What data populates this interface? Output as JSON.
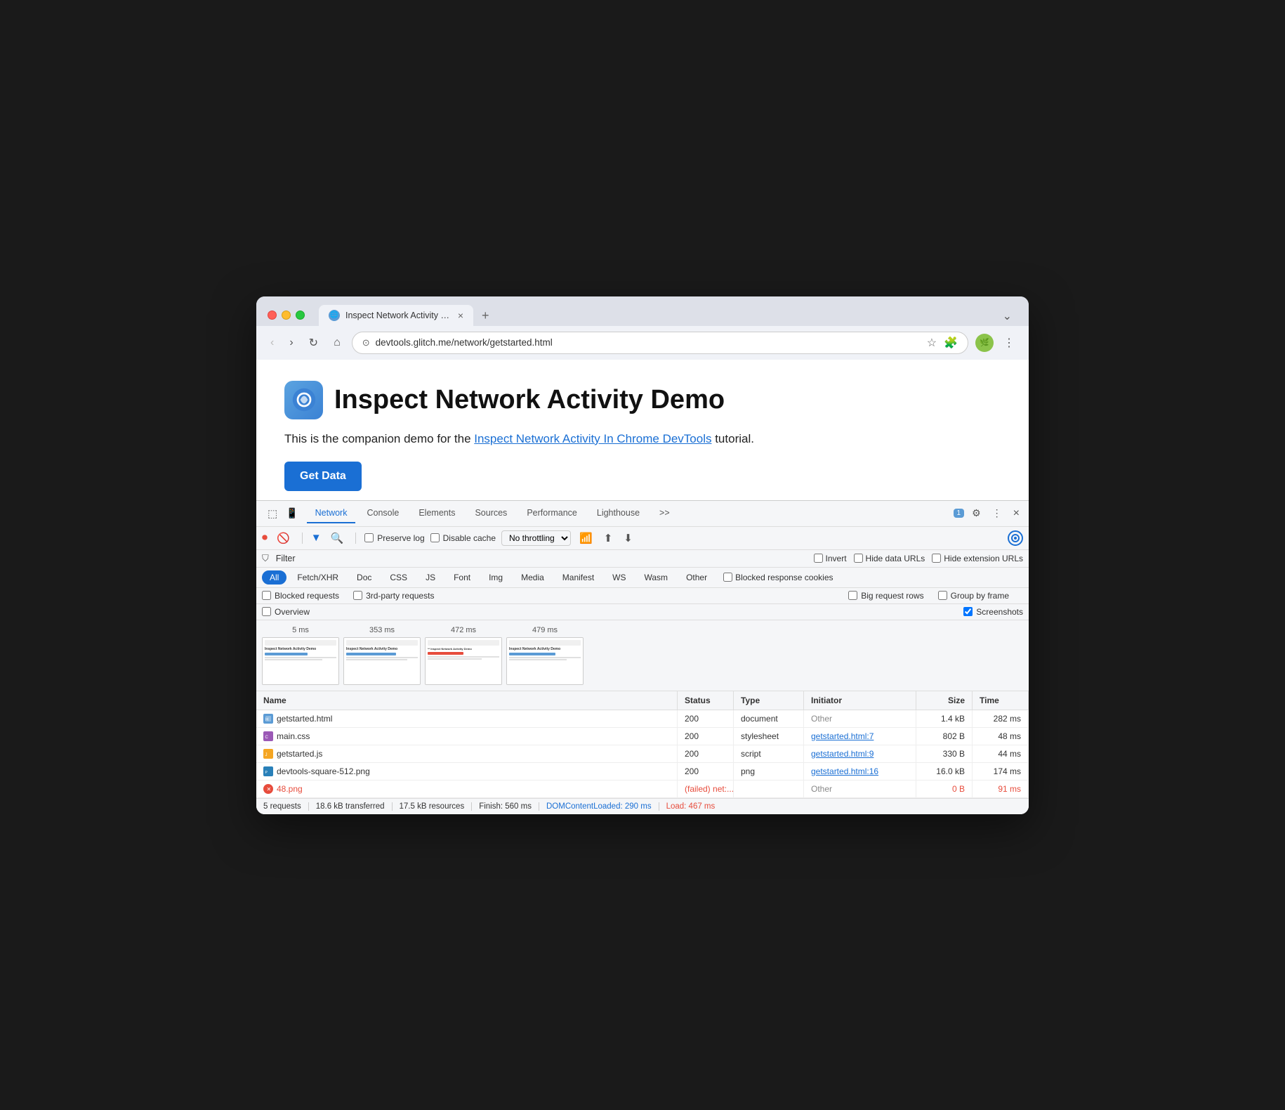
{
  "browser": {
    "tab_title": "Inspect Network Activity Dem",
    "tab_close": "×",
    "new_tab": "+",
    "dropdown_arrow": "⌄",
    "back_btn": "←",
    "forward_btn": "→",
    "refresh_btn": "↻",
    "home_btn": "⌂",
    "address": "devtools.glitch.me/network/getstarted.html",
    "bookmark_icon": "☆",
    "extensions_icon": "🧩",
    "menu_icon": "⋮"
  },
  "page": {
    "title": "Inspect Network Activity Demo",
    "description_before": "This is the companion demo for the ",
    "link_text": "Inspect Network Activity In Chrome DevTools",
    "description_after": " tutorial.",
    "get_data_btn": "Get Data"
  },
  "devtools": {
    "tabs": [
      "Network",
      "Console",
      "Elements",
      "Sources",
      "Performance",
      "Lighthouse",
      ">>"
    ],
    "active_tab": "Network",
    "badge_count": "1",
    "settings_icon": "⚙",
    "more_icon": "⋮",
    "close_icon": "×"
  },
  "network_controls": {
    "stop_recording": "⏹",
    "clear": "🚫",
    "filter_icon": "⛉",
    "search_icon": "🔍",
    "preserve_log": "Preserve log",
    "disable_cache": "Disable cache",
    "throttling": "No throttling",
    "wifi_icon": "📶",
    "upload_icon": "⬆",
    "download_icon": "⬇",
    "settings_ring": "⚙"
  },
  "filter_row": {
    "filter_label": "Filter",
    "invert": "Invert",
    "hide_data_urls": "Hide data URLs",
    "hide_extension_urls": "Hide extension URLs"
  },
  "type_filters": [
    "All",
    "Fetch/XHR",
    "Doc",
    "CSS",
    "JS",
    "Font",
    "Img",
    "Media",
    "Manifest",
    "WS",
    "Wasm",
    "Other"
  ],
  "active_type": "All",
  "blocked_cookies": "Blocked response cookies",
  "options": {
    "blocked_requests": "Blocked requests",
    "third_party": "3rd-party requests",
    "big_rows": "Big request rows",
    "group_by_frame": "Group by frame",
    "overview": "Overview",
    "screenshots": "Screenshots",
    "screenshots_checked": true
  },
  "screenshots": [
    {
      "time": "5 ms"
    },
    {
      "time": "353 ms"
    },
    {
      "time": "472 ms"
    },
    {
      "time": "479 ms"
    }
  ],
  "table": {
    "headers": [
      "Name",
      "Status",
      "Type",
      "Initiator",
      "Size",
      "Time"
    ],
    "rows": [
      {
        "name": "getstarted.html",
        "icon_type": "html",
        "status": "200",
        "type": "document",
        "initiator": "Other",
        "initiator_link": false,
        "size": "1.4 kB",
        "time": "282 ms",
        "error": false
      },
      {
        "name": "main.css",
        "icon_type": "css",
        "status": "200",
        "type": "stylesheet",
        "initiator": "getstarted.html:7",
        "initiator_link": true,
        "size": "802 B",
        "time": "48 ms",
        "error": false
      },
      {
        "name": "getstarted.js",
        "icon_type": "js",
        "status": "200",
        "type": "script",
        "initiator": "getstarted.html:9",
        "initiator_link": true,
        "size": "330 B",
        "time": "44 ms",
        "error": false
      },
      {
        "name": "devtools-square-512.png",
        "icon_type": "png",
        "status": "200",
        "type": "png",
        "initiator": "getstarted.html:16",
        "initiator_link": true,
        "size": "16.0 kB",
        "time": "174 ms",
        "error": false
      },
      {
        "name": "48.png",
        "icon_type": "error",
        "status": "(failed) net:...",
        "type": "",
        "initiator": "Other",
        "initiator_link": false,
        "size": "0 B",
        "time": "91 ms",
        "error": true
      }
    ]
  },
  "status_bar": {
    "requests": "5 requests",
    "transferred": "18.6 kB transferred",
    "resources": "17.5 kB resources",
    "finish": "Finish: 560 ms",
    "dom_content": "DOMContentLoaded: 290 ms",
    "load": "Load: 467 ms"
  }
}
